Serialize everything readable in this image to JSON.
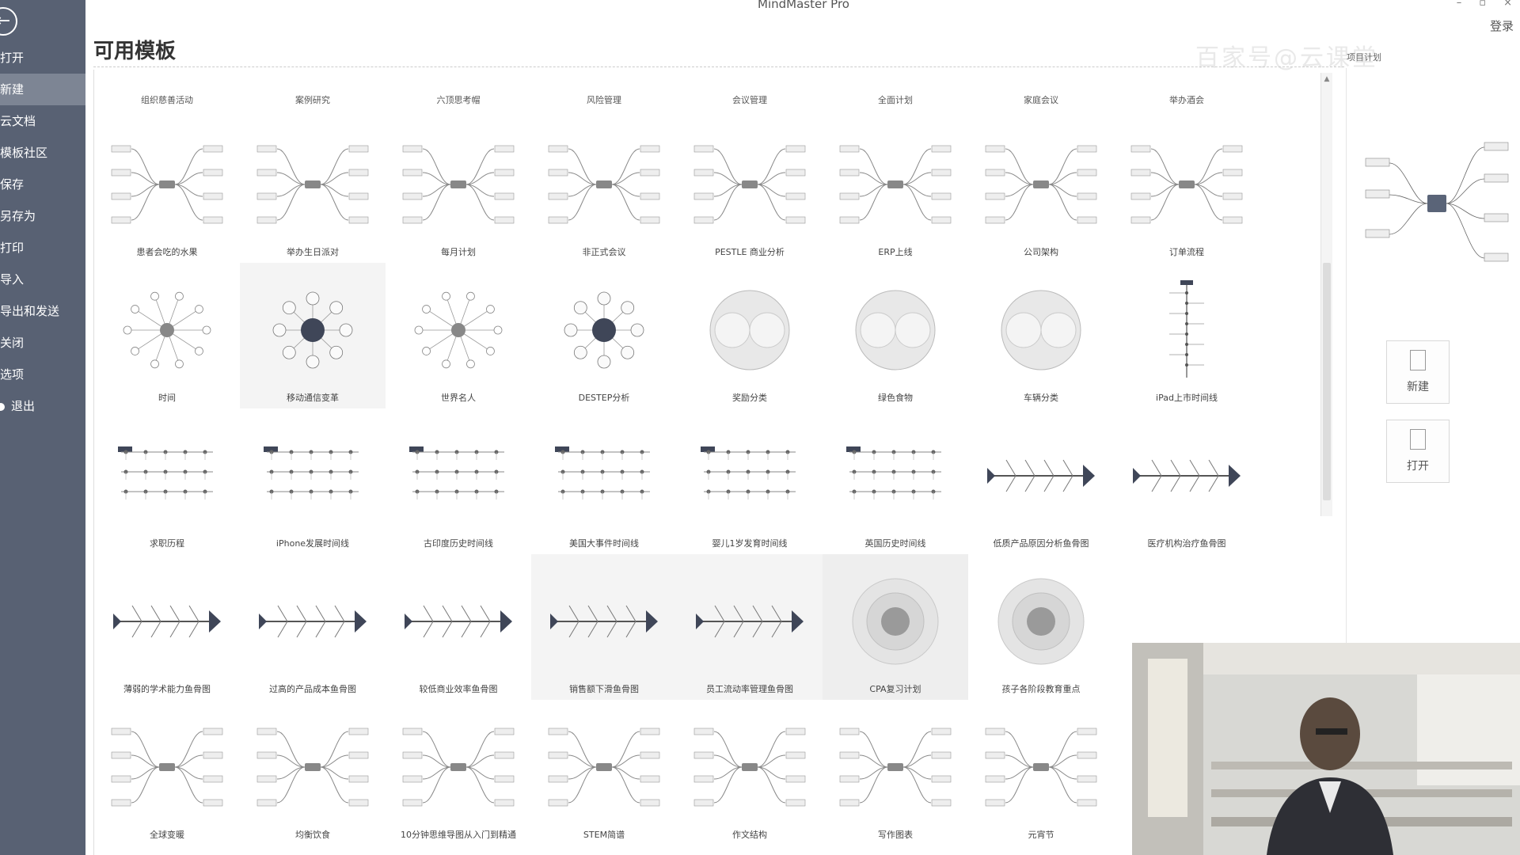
{
  "window": {
    "title": "MindMaster Pro",
    "login": "登录"
  },
  "sidebar": {
    "items": [
      {
        "label": "打开",
        "active": false
      },
      {
        "label": "新建",
        "active": true
      },
      {
        "label": "云文档",
        "active": false
      },
      {
        "label": "模板社区",
        "active": false
      },
      {
        "label": "保存",
        "active": false
      },
      {
        "label": "另存为",
        "active": false
      },
      {
        "label": "打印",
        "active": false
      },
      {
        "label": "导入",
        "active": false
      },
      {
        "label": "导出和发送",
        "active": false
      },
      {
        "label": "关闭",
        "active": false
      },
      {
        "label": "选项",
        "active": false
      },
      {
        "label": "退出",
        "active": false
      }
    ]
  },
  "main": {
    "title": "可用模板",
    "watermark": "百家号@云课堂",
    "top_labels": [
      "组织慈善活动",
      "案例研究",
      "六顶思考帽",
      "风险管理",
      "会议管理",
      "全面计划",
      "家庭会议",
      "举办酒会"
    ],
    "rows": [
      [
        "患者会吃的水果",
        "举办生日派对",
        "每月计划",
        "非正式会议",
        "PESTLE 商业分析",
        "ERP上线",
        "公司架构",
        "订单流程"
      ],
      [
        "时间",
        "移动通信变革",
        "世界名人",
        "DESTEP分析",
        "奖励分类",
        "绿色食物",
        "车辆分类",
        "iPad上市时间线"
      ],
      [
        "求职历程",
        "iPhone发展时间线",
        "古印度历史时间线",
        "美国大事件时间线",
        "婴儿1岁发育时间线",
        "英国历史时间线",
        "低质产品原因分析鱼骨图",
        "医疗机构治疗鱼骨图"
      ],
      [
        "薄弱的学术能力鱼骨图",
        "过高的产品成本鱼骨图",
        "较低商业效率鱼骨图",
        "销售额下滑鱼骨图",
        "员工流动率管理鱼骨图",
        "CPA复习计划",
        "孩子各阶段教育重点",
        ""
      ],
      [
        "全球变暖",
        "均衡饮食",
        "10分钟思维导图从入门到精通",
        "STEM简谱",
        "作文结构",
        "写作图表",
        "元宵节",
        ""
      ]
    ]
  },
  "right_panel": {
    "preview_title": "项目计划",
    "new_label": "新建",
    "open_label": "打开"
  }
}
